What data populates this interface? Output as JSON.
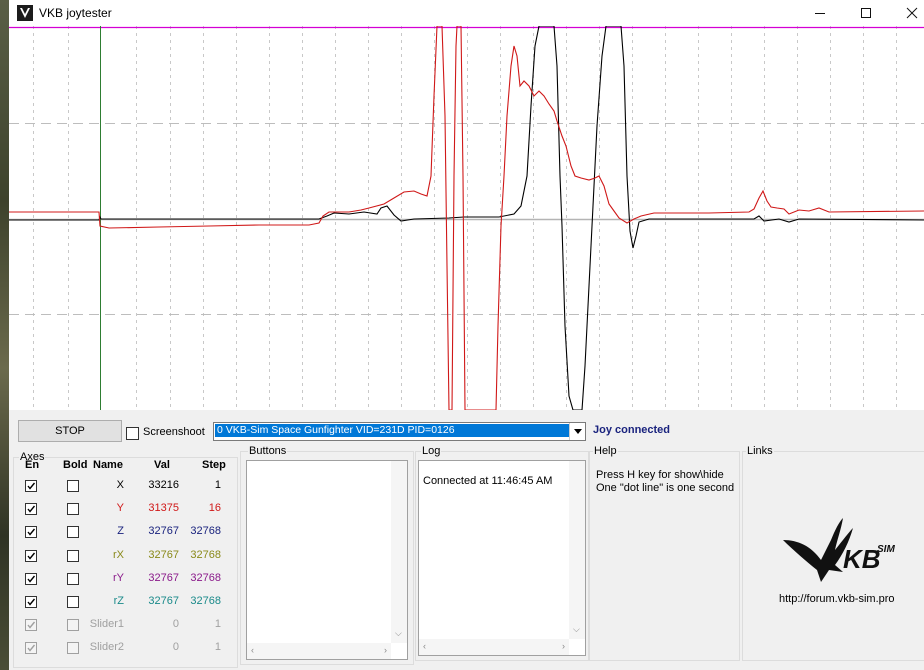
{
  "window": {
    "title": "VKB joytester"
  },
  "toolbar": {
    "stop_label": "STOP",
    "screenshot_label": "Screenshoot",
    "screenshot_checked": false,
    "device": "0  VKB-Sim Space Gunfighter  VID=231D PID=0126",
    "status": "Joy connected"
  },
  "axes": {
    "title": "Axes",
    "headers": [
      "En",
      "Bold",
      "Name",
      "Val",
      "Step"
    ],
    "rows": [
      {
        "enabled": true,
        "bold": false,
        "name": "X",
        "val": "33216",
        "step": "1",
        "color": "#000000",
        "disabled": false
      },
      {
        "enabled": true,
        "bold": false,
        "name": "Y",
        "val": "31375",
        "step": "16",
        "color": "#d01818",
        "disabled": false
      },
      {
        "enabled": true,
        "bold": false,
        "name": "Z",
        "val": "32767",
        "step": "32768",
        "color": "#1a237e",
        "disabled": false
      },
      {
        "enabled": true,
        "bold": false,
        "name": "rX",
        "val": "32767",
        "step": "32768",
        "color": "#8a8a1a",
        "disabled": false
      },
      {
        "enabled": true,
        "bold": false,
        "name": "rY",
        "val": "32767",
        "step": "32768",
        "color": "#8a1a8a",
        "disabled": false
      },
      {
        "enabled": true,
        "bold": false,
        "name": "rZ",
        "val": "32767",
        "step": "32768",
        "color": "#1a8a8a",
        "disabled": false
      },
      {
        "enabled": true,
        "bold": false,
        "name": "Slider1",
        "val": "0",
        "step": "1",
        "color": "#a0a0a0",
        "disabled": true
      },
      {
        "enabled": true,
        "bold": false,
        "name": "Slider2",
        "val": "0",
        "step": "1",
        "color": "#a0a0a0",
        "disabled": true
      }
    ]
  },
  "buttons": {
    "title": "Buttons"
  },
  "log": {
    "title": "Log",
    "entries": [
      "Connected at 11:46:45 AM"
    ]
  },
  "help": {
    "title": "Help",
    "line1": "Press H key for show\\hide",
    "line2": "One \"dot line\" is one second"
  },
  "links": {
    "title": "Links",
    "logo_text": "VKB SIM",
    "url": "http://forum.vkb-sim.pro"
  },
  "colors": {
    "magenta_line": "#d400d4",
    "x_trace": "#000000",
    "y_trace": "#d01818",
    "green_marker": "#2e7d32",
    "selection": "#0078d7"
  },
  "icons": [
    "vkb-app-icon",
    "minimize-icon",
    "maximize-icon",
    "close-icon",
    "dropdown-arrow-icon",
    "checkbox-check-icon",
    "vkb-eagle-logo"
  ]
}
